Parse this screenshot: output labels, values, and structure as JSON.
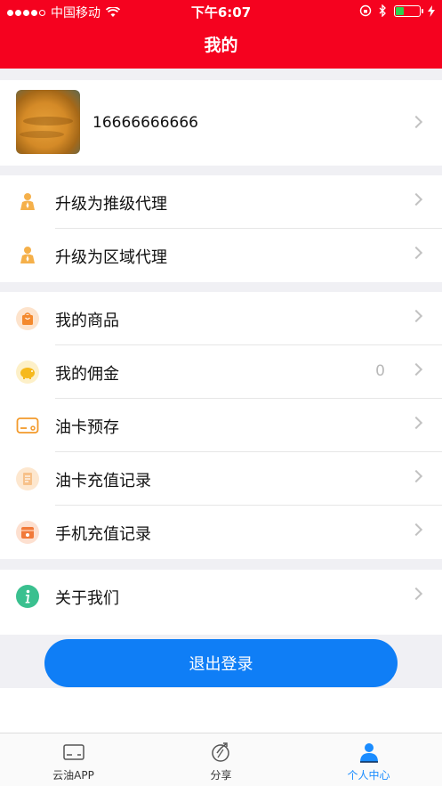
{
  "status_bar": {
    "carrier": "中国移动",
    "time": "下午6:07"
  },
  "header": {
    "title": "我的"
  },
  "profile": {
    "phone": "16666666666"
  },
  "agent_section": [
    {
      "label": "升级为推级代理",
      "icon": "agent-person-icon"
    },
    {
      "label": "升级为区域代理",
      "icon": "agent-person-icon"
    }
  ],
  "menu_section": [
    {
      "label": "我的商品",
      "icon": "shopping-bag-icon",
      "value": ""
    },
    {
      "label": "我的佣金",
      "icon": "piggy-bank-icon",
      "value": "0"
    },
    {
      "label": "油卡预存",
      "icon": "card-icon",
      "value": ""
    },
    {
      "label": "油卡充值记录",
      "icon": "document-icon",
      "value": ""
    },
    {
      "label": "手机充值记录",
      "icon": "phone-recharge-icon",
      "value": ""
    }
  ],
  "about": {
    "label": "关于我们",
    "icon": "info-icon"
  },
  "logout": {
    "label": "退出登录"
  },
  "tabbar": {
    "items": [
      {
        "label": "云油APP",
        "icon": "card-tab-icon",
        "active": false
      },
      {
        "label": "分享",
        "icon": "share-tab-icon",
        "active": false
      },
      {
        "label": "个人中心",
        "icon": "user-tab-icon",
        "active": true
      }
    ]
  },
  "colors": {
    "header": "#f5021f",
    "accent": "#0f7ef6",
    "tab_active": "#1a8cff",
    "icon_orange": "#f39a2b"
  }
}
